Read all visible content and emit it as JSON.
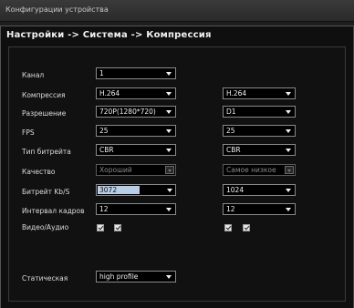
{
  "window": {
    "title": "Конфигурации устройства"
  },
  "header": {
    "breadcrumb": "Настройки -> Система -> Компрессия"
  },
  "labels": {
    "channel": "Канал",
    "compression": "Компрессия",
    "resolution": "Разрешение",
    "fps": "FPS",
    "bitrate_type": "Тип битрейта",
    "quality": "Качество",
    "bitrate": "Битрейт Kb/S",
    "interval": "Интервал кадров",
    "video_audio": "Видео/Аудио",
    "static": "Статическая"
  },
  "main_stream": {
    "channel": "1",
    "compression": "H.264",
    "resolution": "720P(1280*720)",
    "fps": "25",
    "bitrate_type": "CBR",
    "quality": "Хороший",
    "bitrate": "3072",
    "interval": "12",
    "video_checked": true,
    "audio_checked": true,
    "static": "high profile"
  },
  "extra_stream": {
    "compression": "H.264",
    "resolution": "D1",
    "fps": "25",
    "bitrate_type": "CBR",
    "quality": "Самое низкое",
    "bitrate": "1024",
    "interval": "12",
    "video_checked": true,
    "audio_checked": true
  }
}
